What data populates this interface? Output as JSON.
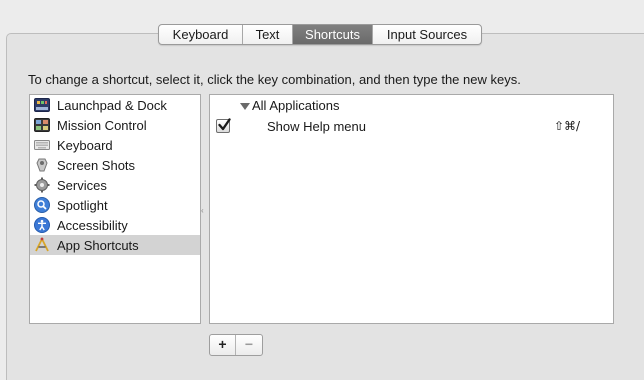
{
  "tabs": [
    {
      "label": "Keyboard",
      "active": false
    },
    {
      "label": "Text",
      "active": false
    },
    {
      "label": "Shortcuts",
      "active": true
    },
    {
      "label": "Input Sources",
      "active": false
    }
  ],
  "instruction": "To change a shortcut, select it, click the key combination, and then type the new keys.",
  "categories": [
    {
      "label": "Launchpad & Dock",
      "icon": "launchpad-dock-icon",
      "selected": false
    },
    {
      "label": "Mission Control",
      "icon": "mission-control-icon",
      "selected": false
    },
    {
      "label": "Keyboard",
      "icon": "keyboard-icon",
      "selected": false
    },
    {
      "label": "Screen Shots",
      "icon": "screenshot-icon",
      "selected": false
    },
    {
      "label": "Services",
      "icon": "gear-icon",
      "selected": false
    },
    {
      "label": "Spotlight",
      "icon": "spotlight-search-icon",
      "selected": false
    },
    {
      "label": "Accessibility",
      "icon": "accessibility-icon",
      "selected": false
    },
    {
      "label": "App Shortcuts",
      "icon": "app-shortcuts-icon",
      "selected": true
    }
  ],
  "shortcuts_panel": {
    "group_label": "All Applications",
    "items": [
      {
        "label": "Show Help menu",
        "shortcut": "⇧⌘/",
        "checked": true
      }
    ]
  },
  "buttons": {
    "add": "+",
    "remove": "−"
  },
  "colors": {
    "selected_row": "#d3d3d3",
    "active_tab": "#757575",
    "checkmark": "#1a1a1a"
  }
}
